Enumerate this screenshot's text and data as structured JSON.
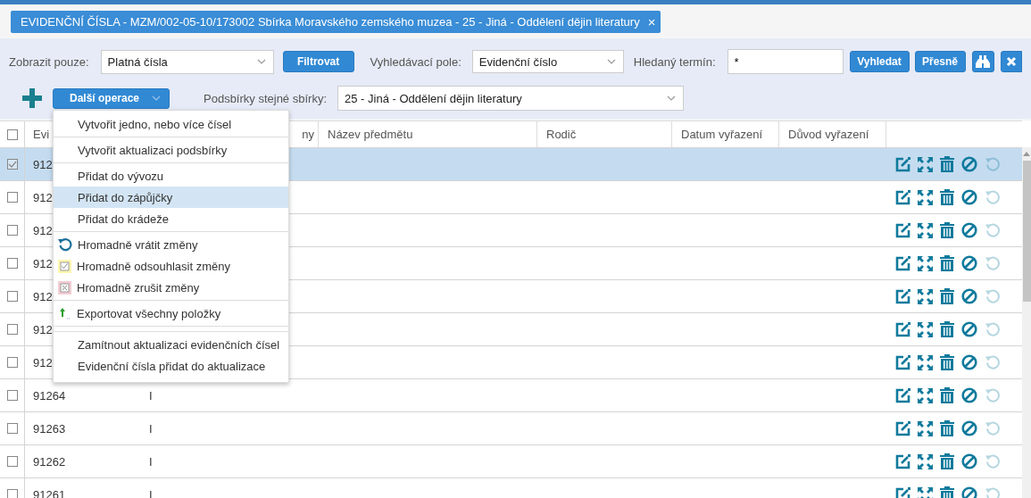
{
  "tab": {
    "title": "EVIDENČNÍ ČÍSLA - MZM/002-05-10/173002 Sbírka Moravského zemského muzea - 25 - Jiná - Oddělení dějin literatury",
    "close": "×"
  },
  "filter": {
    "show_label": "Zobrazit pouze:",
    "show_value": "Platná čísla",
    "filter_button": "Filtrovat",
    "field_label": "Vyhledávací pole:",
    "field_value": "Evidenční číslo",
    "term_label": "Hledaný termín:",
    "term_value": "*",
    "search_button": "Vyhledat",
    "exact_button": "Přesně"
  },
  "toolbar": {
    "operations_button": "Další operace",
    "subcollections_label": "Podsbírky stejné sbírky:",
    "subcollections_value": "25 - Jiná - Oddělení dějin literatury"
  },
  "menu": {
    "groups": [
      [
        {
          "label": "Vytvořit jedno, nebo více čísel",
          "kind": "plain",
          "selected": false
        }
      ],
      [
        {
          "label": "Vytvořit aktualizaci podsbírky",
          "kind": "plain",
          "selected": false
        }
      ],
      [
        {
          "label": "Přidat do vývozu",
          "kind": "plain",
          "selected": false
        },
        {
          "label": "Přidat do zápůjčky",
          "kind": "plain",
          "selected": true
        },
        {
          "label": "Přidat do krádeže",
          "kind": "plain",
          "selected": false
        }
      ],
      [
        {
          "label": "Hromadně vrátit změny",
          "kind": "undo",
          "selected": false
        },
        {
          "label": "Hromadně odsouhlasit změny",
          "kind": "approve",
          "selected": false
        },
        {
          "label": "Hromadně zrušit změny",
          "kind": "cancel",
          "selected": false
        }
      ],
      [
        {
          "label": "Exportovat všechny položky",
          "kind": "export",
          "selected": false
        }
      ],
      [
        {
          "label": "Zamítnout aktualizaci evidenčních čísel",
          "kind": "plain",
          "selected": false
        },
        {
          "label": "Evidenční čísla přidat do aktualizace",
          "kind": "plain",
          "selected": false
        }
      ]
    ]
  },
  "table": {
    "all_checked": false,
    "columns": [
      "Evi",
      "ny",
      "Název předmětu",
      "Rodič",
      "Datum vyřazení",
      "Důvod vyřazení"
    ],
    "rows": [
      {
        "id": "912",
        "checked": true,
        "selected": true,
        "revert_disabled": true
      },
      {
        "id": "912",
        "checked": false,
        "selected": false,
        "revert_disabled": true
      },
      {
        "id": "912",
        "checked": false,
        "selected": false,
        "revert_disabled": true
      },
      {
        "id": "912",
        "checked": false,
        "selected": false,
        "revert_disabled": true
      },
      {
        "id": "912",
        "checked": false,
        "selected": false,
        "revert_disabled": true
      },
      {
        "id": "912",
        "checked": false,
        "selected": false,
        "revert_disabled": true
      },
      {
        "id": "912",
        "checked": false,
        "selected": false,
        "revert_disabled": true
      },
      {
        "id": "91264",
        "column_2": "I",
        "checked": false,
        "selected": false,
        "revert_disabled": true
      },
      {
        "id": "91263",
        "column_2": "I",
        "checked": false,
        "selected": false,
        "revert_disabled": true
      },
      {
        "id": "91262",
        "column_2": "I",
        "checked": false,
        "selected": false,
        "revert_disabled": true
      },
      {
        "id": "91261",
        "column_2": "I",
        "checked": false,
        "selected": false,
        "revert_disabled": true
      }
    ]
  }
}
